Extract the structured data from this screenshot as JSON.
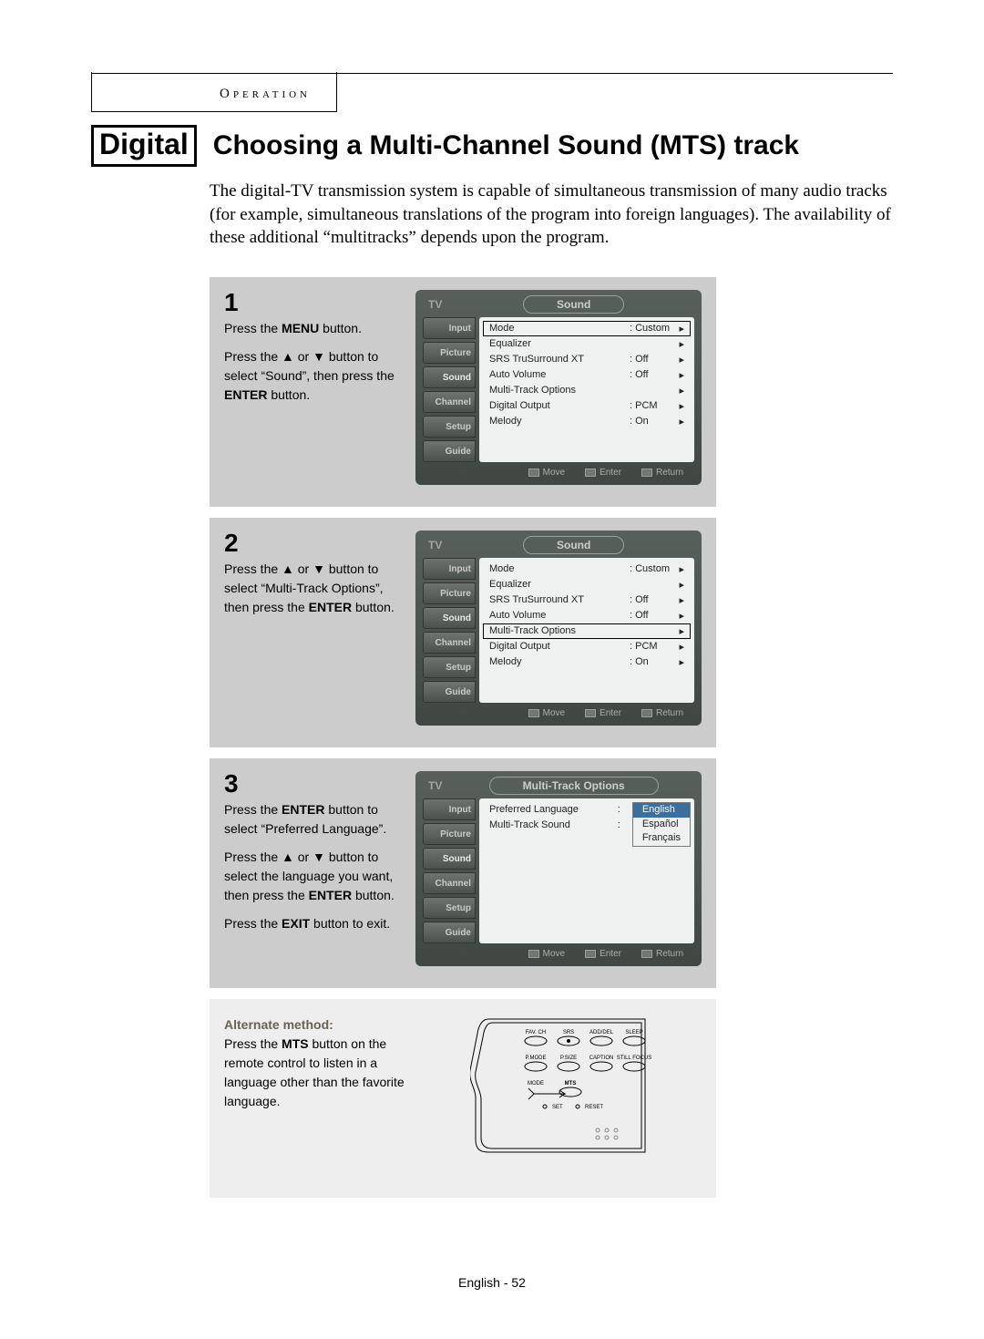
{
  "header": {
    "section": "Operation"
  },
  "title": {
    "tag": "Digital",
    "heading": "Choosing a Multi-Channel Sound (MTS) track"
  },
  "intro": "The digital-TV transmission system is capable of simultaneous transmission of many audio tracks (for example, simultaneous translations of the program into foreign languages). The availability of these additional “multitracks” depends upon the program.",
  "steps": [
    {
      "num": "1",
      "lines": [
        {
          "pre": "Press the ",
          "bold": "MENU",
          "post": " button."
        },
        {
          "pre": "Press the ▲ or ▼ button to select “Sound”, then press the ",
          "bold": "ENTER",
          "post": " button."
        }
      ],
      "osd": {
        "tv": "TV",
        "title": "Sound",
        "tabs": [
          "Input",
          "Picture",
          "Sound",
          "Channel",
          "Setup",
          "Guide"
        ],
        "tabs_active": 2,
        "rows": [
          {
            "label": "Mode",
            "value": ": Custom",
            "sel": true
          },
          {
            "label": "Equalizer",
            "value": "",
            "sel": false
          },
          {
            "label": "SRS TruSurround XT",
            "value": ": Off",
            "sel": false
          },
          {
            "label": "Auto Volume",
            "value": ": Off",
            "sel": false
          },
          {
            "label": "Multi-Track Options",
            "value": "",
            "sel": false
          },
          {
            "label": "Digital Output",
            "value": ": PCM",
            "sel": false
          },
          {
            "label": "Melody",
            "value": ": On",
            "sel": false
          }
        ],
        "footer": [
          "Move",
          "Enter",
          "Return"
        ]
      }
    },
    {
      "num": "2",
      "lines": [
        {
          "pre": "Press the ▲ or ▼ button to select “Multi-Track Options”, then press the ",
          "bold": "ENTER",
          "post": " button."
        }
      ],
      "osd": {
        "tv": "TV",
        "title": "Sound",
        "tabs": [
          "Input",
          "Picture",
          "Sound",
          "Channel",
          "Setup",
          "Guide"
        ],
        "tabs_active": 2,
        "rows": [
          {
            "label": "Mode",
            "value": ": Custom",
            "sel": false
          },
          {
            "label": "Equalizer",
            "value": "",
            "sel": false
          },
          {
            "label": "SRS TruSurround XT",
            "value": ": Off",
            "sel": false
          },
          {
            "label": "Auto Volume",
            "value": ": Off",
            "sel": false
          },
          {
            "label": "Multi-Track Options",
            "value": "",
            "sel": true
          },
          {
            "label": "Digital Output",
            "value": ": PCM",
            "sel": false
          },
          {
            "label": "Melody",
            "value": ": On",
            "sel": false
          }
        ],
        "footer": [
          "Move",
          "Enter",
          "Return"
        ]
      }
    },
    {
      "num": "3",
      "lines": [
        {
          "pre": "Press the ",
          "bold": "ENTER",
          "post": " button to select “Preferred Language”."
        },
        {
          "pre": "Press the ▲ or ▼ button to select the language you want, then press the ",
          "bold": "ENTER",
          "post": " button."
        },
        {
          "pre": "Press the ",
          "bold": "EXIT",
          "post": " button to exit."
        }
      ],
      "osd": {
        "tv": "TV",
        "title": "Multi-Track Options",
        "tabs": [
          "Input",
          "Picture",
          "Sound",
          "Channel",
          "Setup",
          "Guide"
        ],
        "tabs_active": 2,
        "panel_lang": {
          "rows": [
            {
              "label": "Preferred Language",
              "value": ":"
            },
            {
              "label": "Multi-Track Sound",
              "value": ":"
            }
          ],
          "options": [
            "English",
            "Español",
            "Français"
          ],
          "selected": 0
        },
        "footer": [
          "Move",
          "Enter",
          "Return"
        ]
      }
    }
  ],
  "alt": {
    "heading": "Alternate method:",
    "body_pre": "Press the ",
    "body_bold": "MTS",
    "body_post": " button on the remote control to listen in a language other than the favorite language."
  },
  "remote_labels": {
    "row1": [
      "FAV. CH",
      "SRS",
      "ADD/DEL",
      "SLEEP"
    ],
    "row2": [
      "P.MODE",
      "P.SIZE",
      "CAPTION",
      "STILL FOCUS"
    ],
    "mts": "MTS",
    "mode": "MODE",
    "set": "SET",
    "reset": "RESET"
  },
  "footer": {
    "text": "English - 52"
  }
}
